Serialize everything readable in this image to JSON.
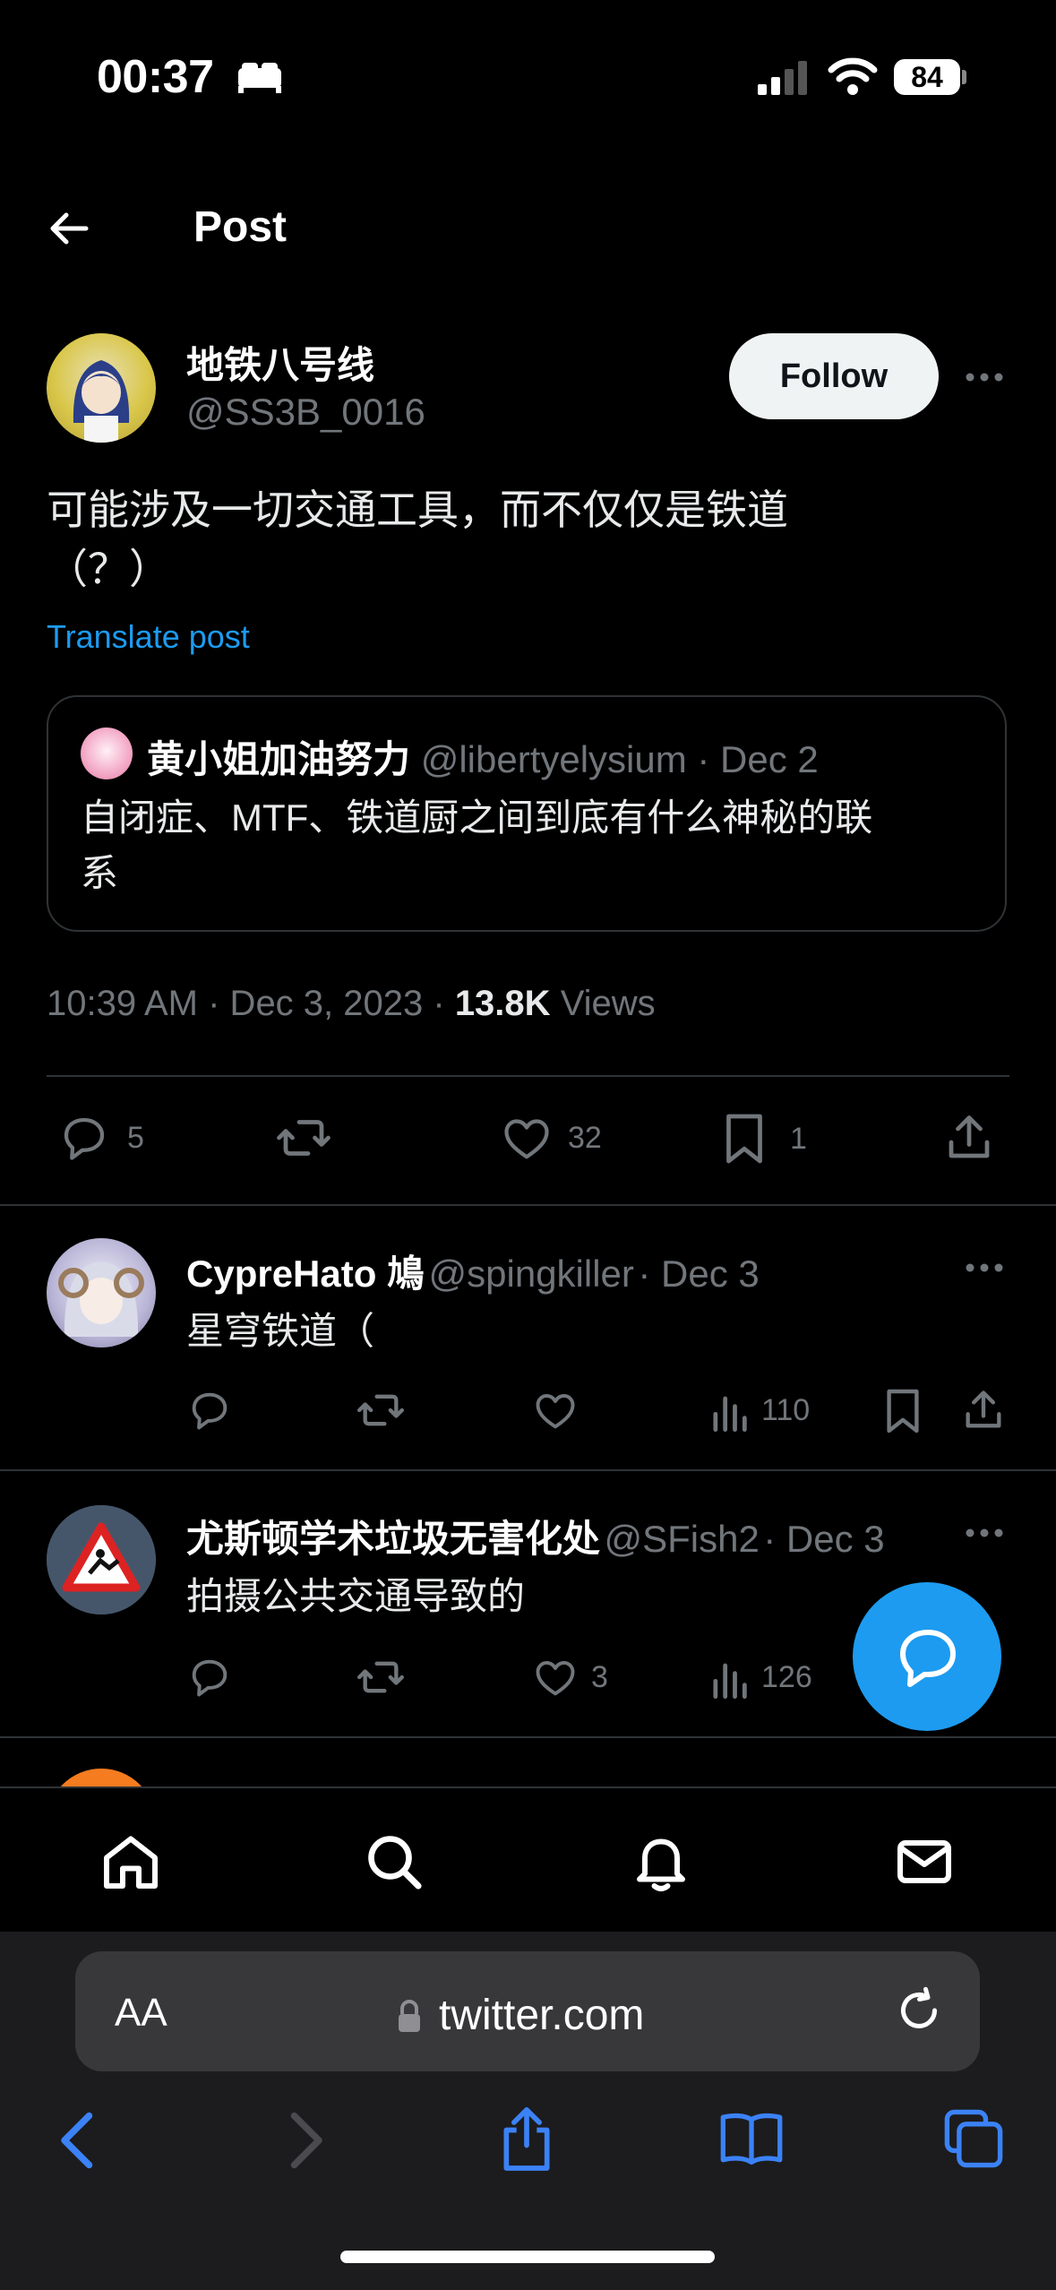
{
  "status_bar": {
    "time": "00:37",
    "battery": "84"
  },
  "header": {
    "title": "Post"
  },
  "post": {
    "author_name": "地铁八号线",
    "author_handle": "@SS3B_0016",
    "follow_label": "Follow",
    "text_line1": "可能涉及一切交通工具，而不仅仅是铁道",
    "text_line2": "（？）",
    "translate_label": "Translate post",
    "quote": {
      "author_name": "黄小姐加油努力",
      "author_handle": "@libertyelysium",
      "date": "· Dec 2",
      "text_line1": "自闭症、MTF、铁道厨之间到底有什么神秘的联",
      "text_line2": "系"
    },
    "time": "10:39 AM · Dec 3, 2023 ·",
    "views_count": "13.8K",
    "views_label": "Views",
    "actions": {
      "replies": "5",
      "likes": "32",
      "bookmarks": "1"
    }
  },
  "replies": [
    {
      "author_name": "CypreHato 鳩",
      "author_handle": "@spingkiller",
      "date": "· Dec 3",
      "text": "星穹铁道（",
      "likes": "",
      "views": "110"
    },
    {
      "author_name": "尤斯顿学术垃圾无害化处",
      "author_handle": "@SFish2",
      "date": "· Dec 3",
      "text": "拍摄公共交通导致的",
      "likes": "3",
      "views": "126"
    }
  ],
  "browser": {
    "aa_label": "AA",
    "url": "twitter.com"
  },
  "colors": {
    "accent": "#1d9bf0",
    "background": "#000000",
    "muted": "#71767b"
  }
}
